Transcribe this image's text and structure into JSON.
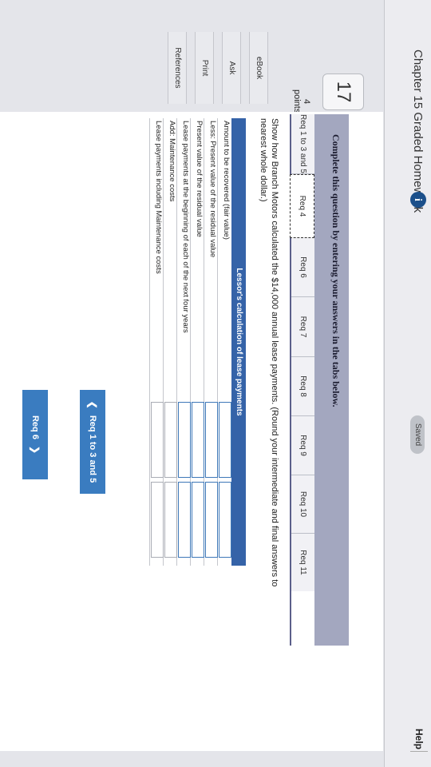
{
  "header": {
    "title": "Chapter 15 Graded Homework",
    "info_badge": "i",
    "saved": "Saved",
    "help": "Help"
  },
  "question": {
    "number": "17",
    "points_value": "4",
    "points_label": "points"
  },
  "sidebar": [
    "eBook",
    "Ask",
    "Print",
    "References"
  ],
  "instructions": "Complete this question by entering your answers in the tabs below.",
  "tabs": [
    {
      "label": "Req 1 to 3 and 5",
      "active": false
    },
    {
      "label": "Req 4",
      "active": true
    },
    {
      "label": "Req 6",
      "active": false
    },
    {
      "label": "Req 7",
      "active": false
    },
    {
      "label": "Req 8",
      "active": false
    },
    {
      "label": "Req 9",
      "active": false
    },
    {
      "label": "Req 10",
      "active": false
    },
    {
      "label": "Req 11",
      "active": false
    }
  ],
  "prompt": {
    "line1": "Show how Branch Motors calculated the $14,000 annual lease payments. (Round your intermediate and final answers to",
    "line2": "nearest whole dollar.)"
  },
  "table": {
    "heading": "Lessor's calculation of lease payments",
    "rows": [
      {
        "label": "Amount to be recovered (fair value)",
        "cells": [
          "input",
          "input"
        ]
      },
      {
        "label": "Less: Present value of the residual value",
        "cells": [
          "input",
          "input"
        ]
      },
      {
        "label": "Present value of the residual value",
        "cells": [
          "input",
          "input"
        ]
      },
      {
        "label": "Lease payments at the beginning of each of the next four years",
        "cells": [
          "input",
          "input"
        ]
      },
      {
        "label": "Add: Maintenance costs",
        "cells": [
          "plain",
          "plain"
        ]
      },
      {
        "label": "Lease payments including Maintenance costs",
        "cells": [
          "plain",
          "plain"
        ]
      }
    ]
  },
  "nav": {
    "prev_label": "Req 1 to 3 and 5",
    "next_label": "Req 6",
    "prev_icon": "chevron-left-icon",
    "next_icon": "chevron-right-icon"
  },
  "colors": {
    "accent": "#3a7cc0",
    "table_header": "#3563a8",
    "instruction_band": "#a3a7bf"
  }
}
